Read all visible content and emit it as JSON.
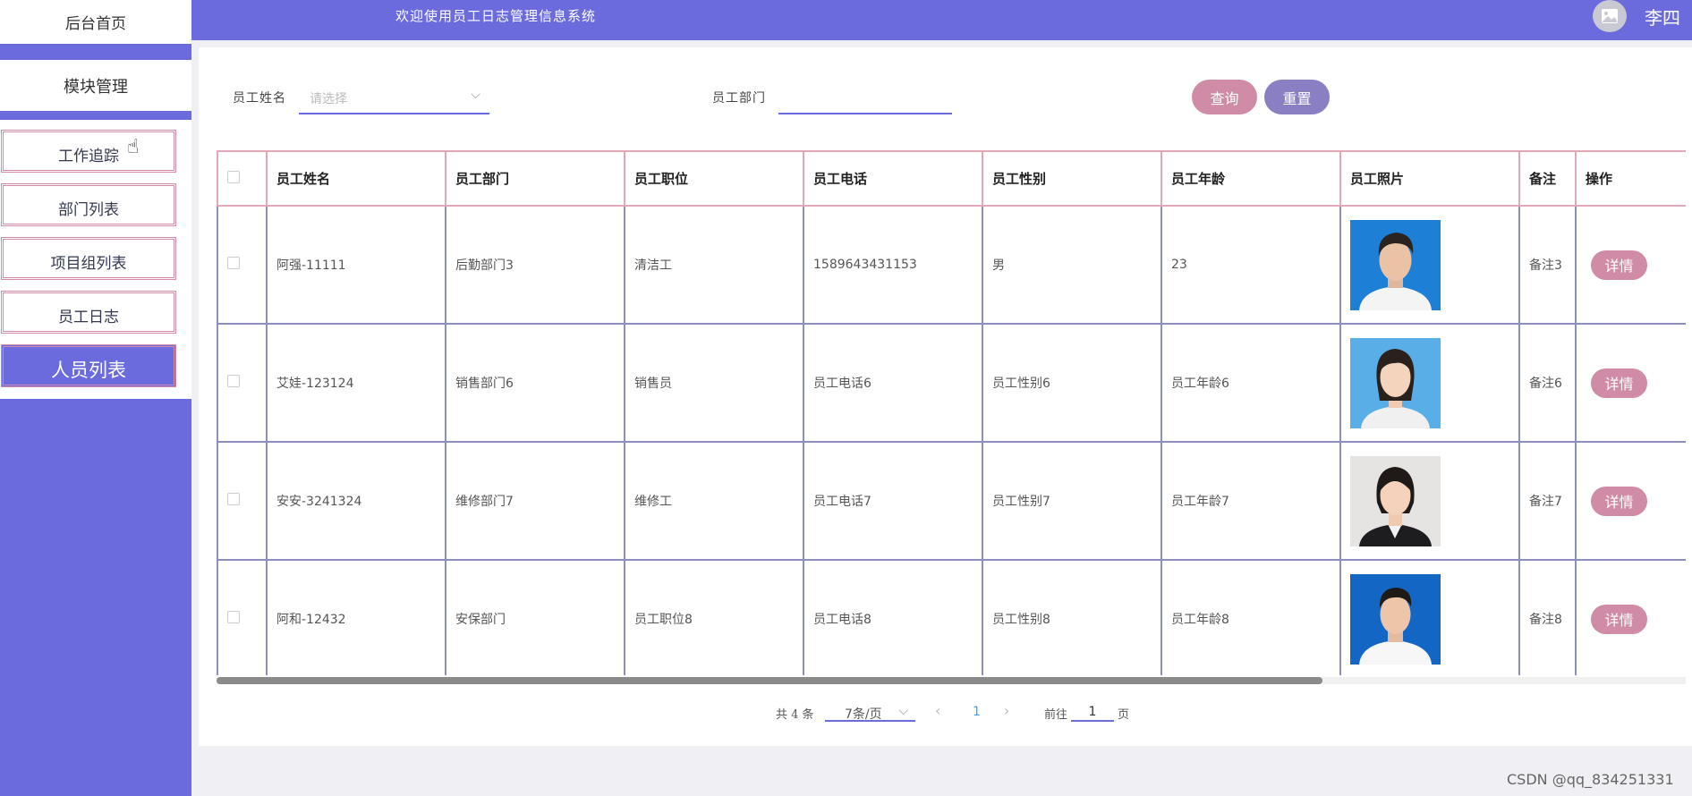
{
  "header": {
    "welcome": "欢迎使用员工日志管理信息系统",
    "username": "李四",
    "avatar_icon": "image-icon"
  },
  "sidebar": {
    "home": "后台首页",
    "module": "模块管理",
    "items": [
      {
        "label": "工作追踪",
        "active": false
      },
      {
        "label": "部门列表",
        "active": false
      },
      {
        "label": "项目组列表",
        "active": false
      },
      {
        "label": "员工日志",
        "active": false
      },
      {
        "label": "人员列表",
        "active": true
      }
    ]
  },
  "filter": {
    "name_label": "员工姓名",
    "name_placeholder": "请选择",
    "dept_label": "员工部门",
    "dept_value": "",
    "query_label": "查询",
    "reset_label": "重置"
  },
  "table": {
    "columns": [
      "员工姓名",
      "员工部门",
      "员工职位",
      "员工电话",
      "员工性别",
      "员工年龄",
      "员工照片",
      "备注",
      "操作"
    ],
    "rows": [
      {
        "name": "阿强-11111",
        "dept": "后勤部门3",
        "position": "清洁工",
        "phone": "1589643431153",
        "gender": "男",
        "age": "23",
        "photo": "male-portrait",
        "note": "备注3",
        "action": "详情"
      },
      {
        "name": "艾娃-123124",
        "dept": "销售部门6",
        "position": "销售员",
        "phone": "员工电话6",
        "gender": "员工性别6",
        "age": "员工年龄6",
        "photo": "female-portrait",
        "note": "备注6",
        "action": "详情"
      },
      {
        "name": "安安-3241324",
        "dept": "维修部门7",
        "position": "维修工",
        "phone": "员工电话7",
        "gender": "员工性别7",
        "age": "员工年龄7",
        "photo": "female-portrait",
        "note": "备注7",
        "action": "详情"
      },
      {
        "name": "阿和-12432",
        "dept": "安保部门",
        "position": "员工职位8",
        "phone": "员工电话8",
        "gender": "员工性别8",
        "age": "员工年龄8",
        "photo": "male-portrait",
        "note": "备注8",
        "action": "详情"
      }
    ]
  },
  "pagination": {
    "total": "共 4 条",
    "page_size": "7条/页",
    "current_page": "1",
    "goto_label": "前往",
    "goto_value": "1",
    "page_suffix": "页"
  },
  "watermark": "CSDN @qq_834251331",
  "colors": {
    "primary": "#6b6bde",
    "query_button": "#d08ba6",
    "reset_button": "#8b7fc4",
    "active_page": "#409eff"
  }
}
